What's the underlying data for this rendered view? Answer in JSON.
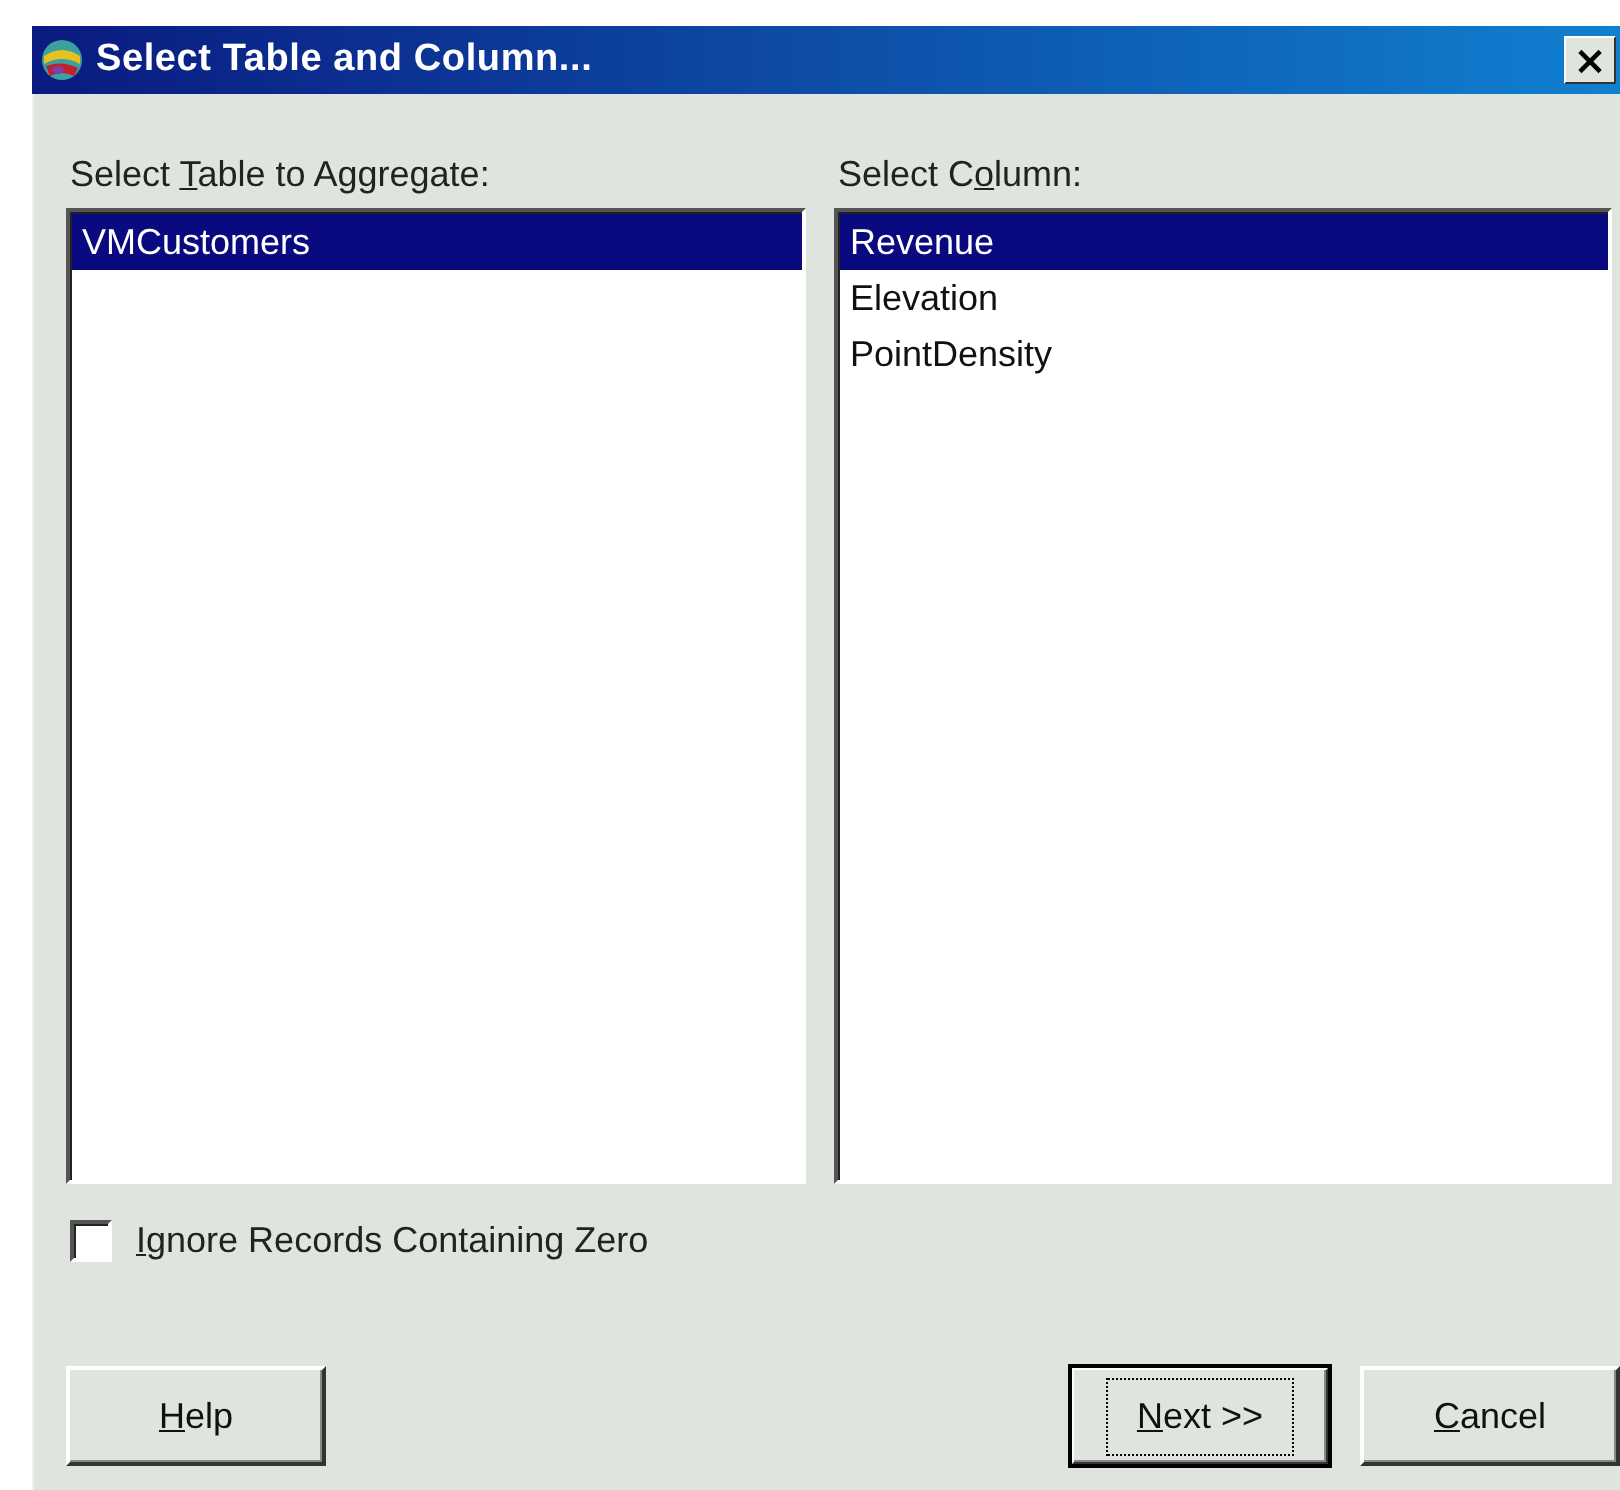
{
  "window": {
    "title": "Select Table and Column...",
    "close": "×"
  },
  "table_list": {
    "label": {
      "before": "Select ",
      "key": "T",
      "after": "able to Aggregate:"
    },
    "items": [
      {
        "text": "VMCustomers",
        "selected": true
      }
    ]
  },
  "column_list": {
    "label": {
      "before": "Select C",
      "key": "o",
      "after": "lumn:"
    },
    "items": [
      {
        "text": "Revenue",
        "selected": true
      },
      {
        "text": "Elevation",
        "selected": false
      },
      {
        "text": "PointDensity",
        "selected": false
      }
    ]
  },
  "ignore_zero": {
    "label": {
      "key": "I",
      "after": "gnore Records Containing Zero"
    },
    "checked": false
  },
  "buttons": [
    {
      "label": {
        "key": "H",
        "after": "elp"
      },
      "default": false
    },
    {
      "label": {
        "key": "N",
        "after": "ext >>"
      },
      "default": true
    },
    {
      "label": {
        "key": "C",
        "after": "ancel"
      },
      "default": false
    }
  ]
}
